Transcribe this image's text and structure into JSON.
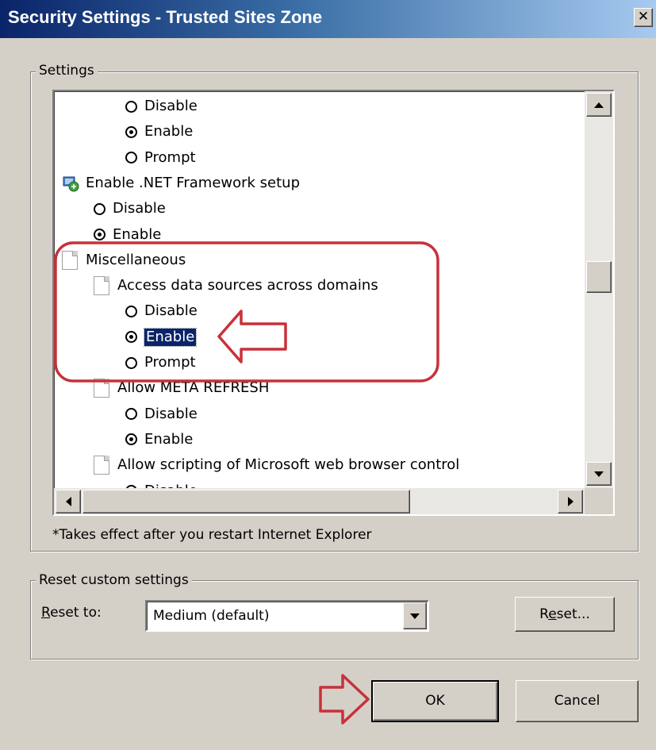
{
  "window": {
    "title": "Security Settings - Trusted Sites Zone",
    "close_glyph": "✕"
  },
  "settings": {
    "group_label": "Settings",
    "items": [
      {
        "kind": "radio",
        "label": "Disable",
        "checked": false
      },
      {
        "kind": "radio",
        "label": "Enable",
        "checked": true
      },
      {
        "kind": "radio",
        "label": "Prompt",
        "checked": false
      },
      {
        "kind": "category",
        "label": "Enable .NET Framework setup",
        "icon": "dotnet-setup-icon"
      },
      {
        "kind": "radio",
        "label": "Disable",
        "checked": false
      },
      {
        "kind": "radio",
        "label": "Enable",
        "checked": true
      },
      {
        "kind": "category",
        "label": "Miscellaneous",
        "icon": "document-icon"
      },
      {
        "kind": "setting",
        "label": "Access data sources across domains",
        "icon": "document-icon"
      },
      {
        "kind": "radio",
        "label": "Disable",
        "checked": false
      },
      {
        "kind": "radio",
        "label": "Enable",
        "checked": true,
        "selected": true
      },
      {
        "kind": "radio",
        "label": "Prompt",
        "checked": false
      },
      {
        "kind": "setting",
        "label": "Allow META REFRESH",
        "icon": "document-icon"
      },
      {
        "kind": "radio",
        "label": "Disable",
        "checked": false
      },
      {
        "kind": "radio",
        "label": "Enable",
        "checked": true
      },
      {
        "kind": "setting",
        "label": "Allow scripting of Microsoft web browser control",
        "icon": "document-icon"
      },
      {
        "kind": "radio",
        "label": "Disable",
        "checked": true
      }
    ],
    "note": "*Takes effect after you restart Internet Explorer"
  },
  "reset": {
    "group_label": "Reset custom settings",
    "label": "Reset to:",
    "selected_value": "Medium (default)",
    "button_label": "Reset..."
  },
  "footer": {
    "ok_label": "OK",
    "cancel_label": "Cancel"
  },
  "annotations": {
    "highlight_color": "#c8313a"
  }
}
